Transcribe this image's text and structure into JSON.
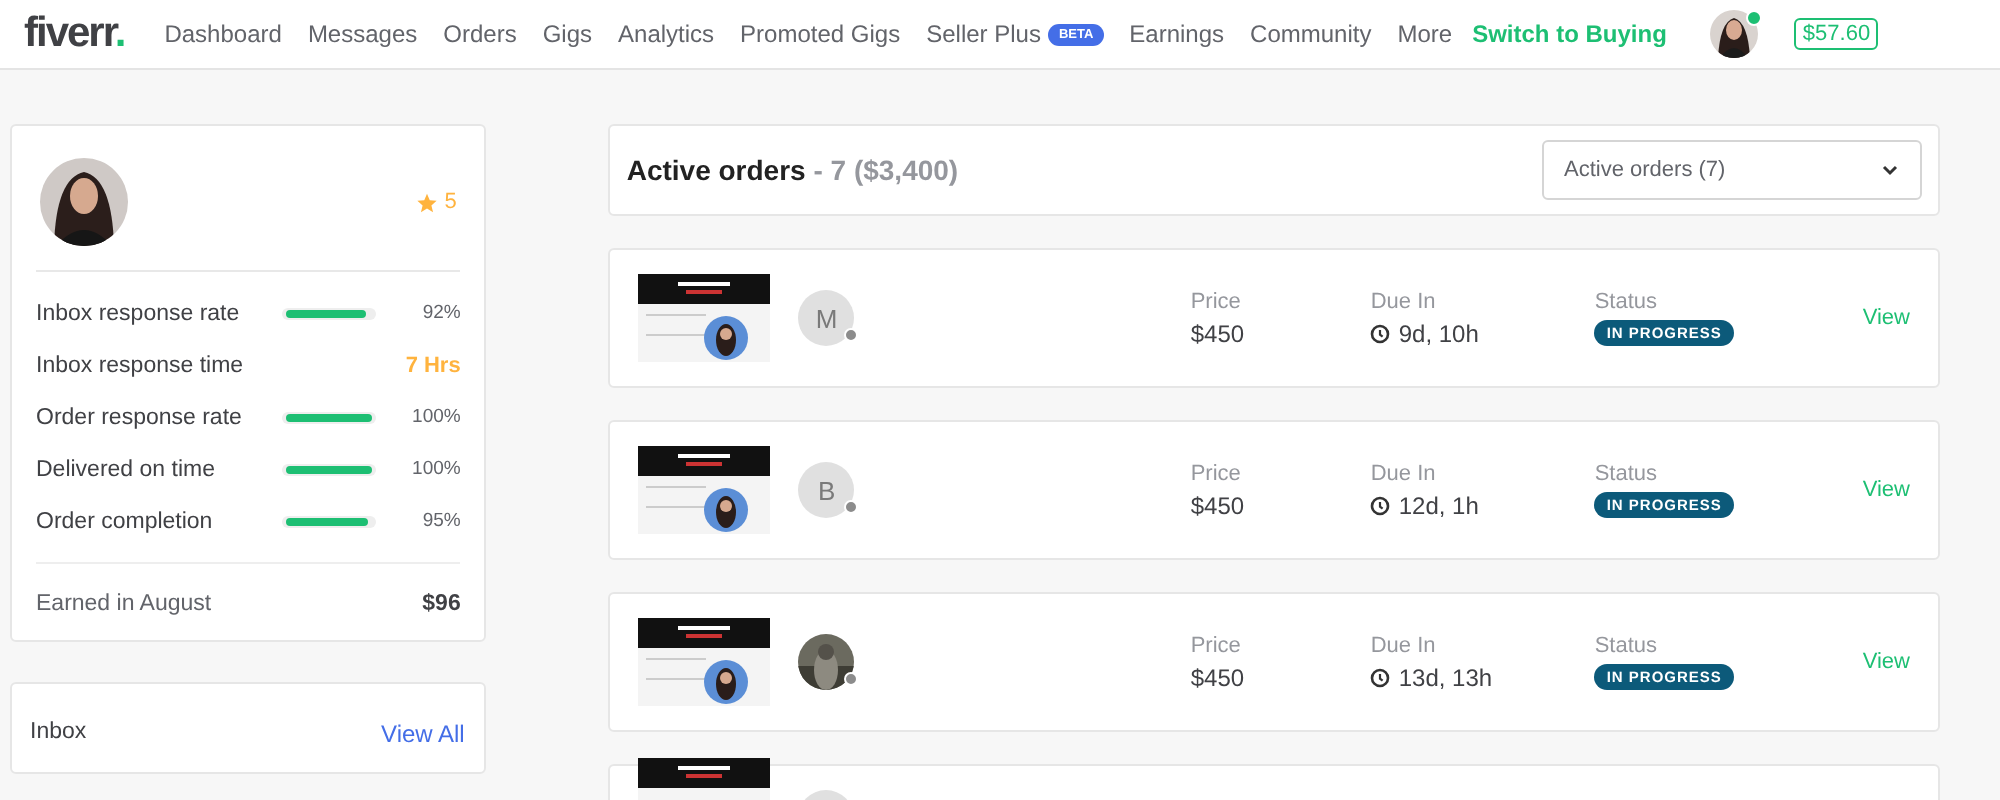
{
  "nav": {
    "logo": "fiverr",
    "logo_dot": ".",
    "items": [
      {
        "label": "Dashboard"
      },
      {
        "label": "Messages"
      },
      {
        "label": "Orders"
      },
      {
        "label": "Gigs"
      },
      {
        "label": "Analytics"
      },
      {
        "label": "Promoted Gigs"
      },
      {
        "label": "Seller Plus",
        "badge": "BETA"
      },
      {
        "label": "Earnings"
      },
      {
        "label": "Community"
      },
      {
        "label": "More"
      }
    ],
    "switch_link": "Switch to Buying",
    "online": true,
    "balance": "$57.60"
  },
  "profile": {
    "rating": "5",
    "metrics": [
      {
        "kind": "bar",
        "label": "Inbox response rate",
        "level": 0.92,
        "value": "92%"
      },
      {
        "kind": "text",
        "label": "Inbox response time",
        "value": "7 Hrs"
      },
      {
        "kind": "bar",
        "label": "Order response rate",
        "level": 1.0,
        "value": "100%"
      },
      {
        "kind": "bar",
        "label": "Delivered on time",
        "level": 1.0,
        "value": "100%"
      },
      {
        "kind": "bar",
        "label": "Order completion",
        "level": 0.95,
        "value": "95%"
      }
    ],
    "earned_label": "Earned in August",
    "earned_value": "$96"
  },
  "inbox": {
    "title": "Inbox",
    "link": "View All"
  },
  "orders_header": {
    "title": "Active orders",
    "summary": "- 7 ($3,400)",
    "filter": "Active orders (7)"
  },
  "orders": [
    {
      "kind": "initial",
      "initial": "M",
      "price_label": "Price",
      "price": "$450",
      "due_label": "Due In",
      "due": "9d, 10h",
      "status_label": "Status",
      "status": "IN PROGRESS",
      "action": "View"
    },
    {
      "kind": "initial",
      "initial": "B",
      "price_label": "Price",
      "price": "$450",
      "due_label": "Due In",
      "due": "12d, 1h",
      "status_label": "Status",
      "status": "IN PROGRESS",
      "action": "View"
    },
    {
      "kind": "picture",
      "price_label": "Price",
      "price": "$450",
      "due_label": "Due In",
      "due": "13d, 13h",
      "status_label": "Status",
      "status": "IN PROGRESS",
      "action": "View"
    }
  ],
  "partial_order": {
    "kind": "initial"
  }
}
